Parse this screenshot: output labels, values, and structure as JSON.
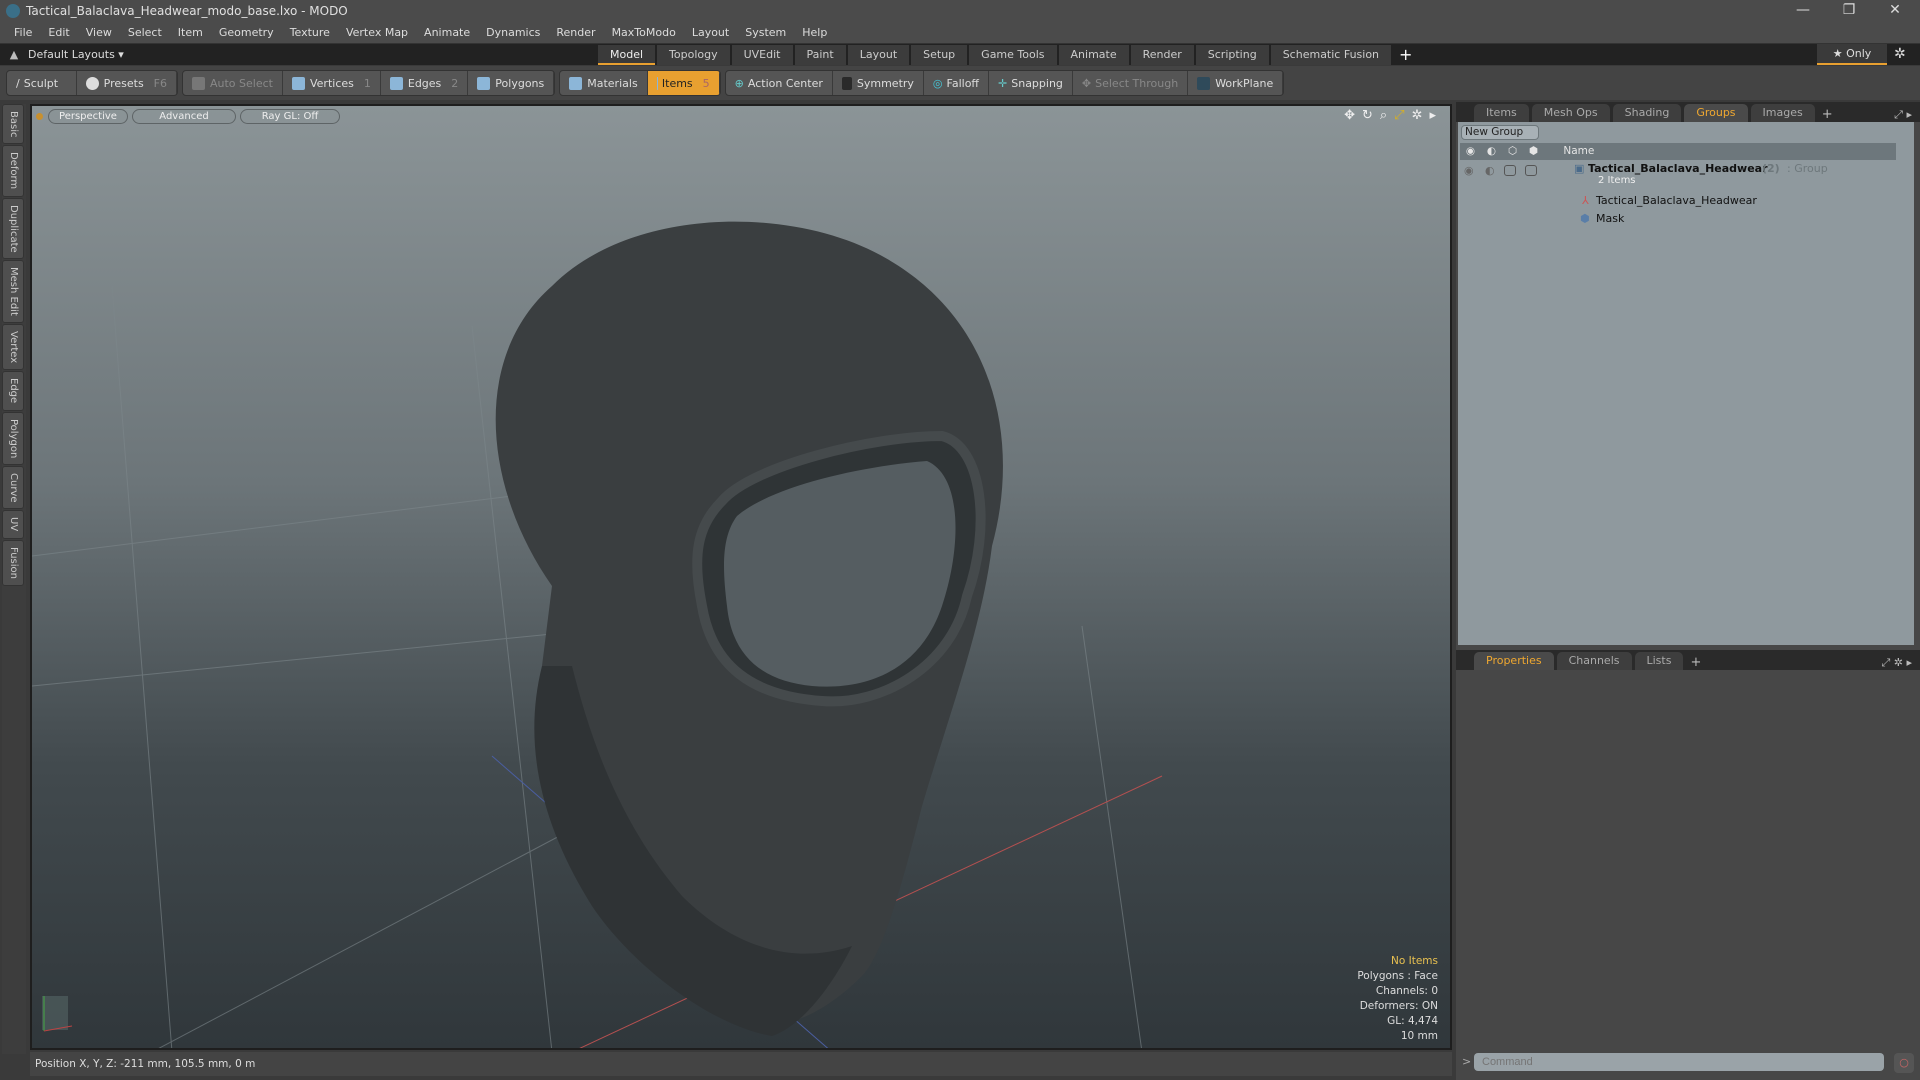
{
  "window": {
    "title": "Tactical_Balaclava_Headwear_modo_base.lxo - MODO",
    "minimize": "—",
    "restore": "❐",
    "close": "✕"
  },
  "menu": [
    "File",
    "Edit",
    "View",
    "Select",
    "Item",
    "Geometry",
    "Texture",
    "Vertex Map",
    "Animate",
    "Dynamics",
    "Render",
    "MaxToModo",
    "Layout",
    "System",
    "Help"
  ],
  "layouts": {
    "label": "Default Layouts ▾",
    "tabs": [
      "Model",
      "Topology",
      "UVEdit",
      "Paint",
      "Layout",
      "Setup",
      "Game Tools",
      "Animate",
      "Render",
      "Scripting",
      "Schematic Fusion"
    ],
    "active": "Model",
    "add": "+",
    "only": "★  Only"
  },
  "toolbar": {
    "sculpt": "Sculpt",
    "presets": "Presets",
    "presets_key": "F6",
    "auto_select": "Auto Select",
    "vertices": "Vertices",
    "vertices_key": "1",
    "edges": "Edges",
    "edges_key": "2",
    "polygons": "Polygons",
    "materials": "Materials",
    "items": "Items",
    "items_key": "5",
    "action_center": "Action Center",
    "symmetry": "Symmetry",
    "falloff": "Falloff",
    "snapping": "Snapping",
    "select_through": "Select Through",
    "workplane": "WorkPlane"
  },
  "left_tabs": [
    "Basic",
    "Deform",
    "Duplicate",
    "Mesh Edit",
    "Vertex",
    "Edge",
    "Polygon",
    "Curve",
    "UV",
    "Fusion"
  ],
  "viewport": {
    "view": "Perspective",
    "shading": "Advanced",
    "raygl": "Ray GL: Off",
    "info": {
      "selection": "No Items",
      "mode": "Polygons : Face",
      "channels": "Channels: 0",
      "deformers": "Deformers: ON",
      "gl": "GL: 4,474",
      "scale": "10 mm"
    }
  },
  "status": {
    "position": "Position X, Y, Z:   -211 mm, 105.5 mm, 0 m"
  },
  "groups_panel": {
    "tabs": [
      "Items",
      "Mesh Ops",
      "Shading",
      "Groups",
      "Images"
    ],
    "active": "Groups",
    "add": "+",
    "new_group": "New Group",
    "col_name": "Name",
    "group": {
      "name": "Tactical_Balaclava_Headwear",
      "count": "(2)",
      "type": ": Group",
      "sub": "2 Items"
    },
    "children": [
      "Tactical_Balaclava_Headwear",
      "Mask"
    ]
  },
  "properties_panel": {
    "tabs": [
      "Properties",
      "Channels",
      "Lists"
    ],
    "active": "Properties",
    "add": "+"
  },
  "command": {
    "prompt": ">",
    "placeholder": "Command"
  }
}
